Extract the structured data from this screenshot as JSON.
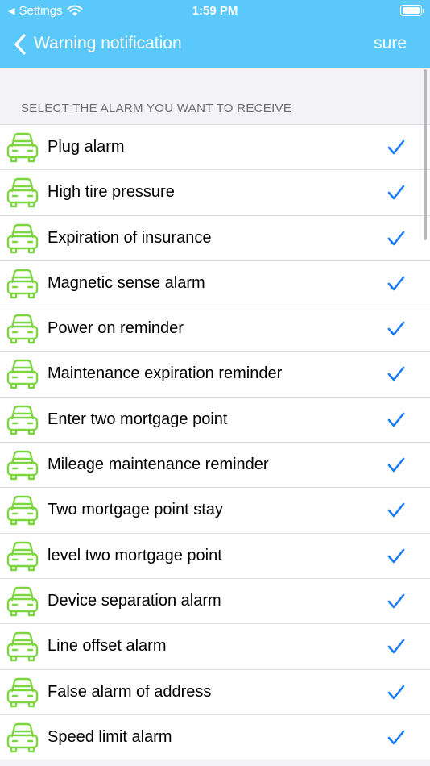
{
  "status_bar": {
    "back_app": "Settings",
    "time": "1:59 PM"
  },
  "nav": {
    "title": "Warning notification",
    "action": "sure"
  },
  "section": {
    "title": "SELECT THE ALARM YOU WANT TO RECEIVE"
  },
  "colors": {
    "header_bg": "#5ac8fa",
    "car_icon": "#7cd63d",
    "check": "#1a7cf5"
  },
  "alarms": [
    {
      "label": "Plug alarm",
      "checked": true
    },
    {
      "label": "High tire pressure",
      "checked": true
    },
    {
      "label": "Expiration of insurance",
      "checked": true
    },
    {
      "label": "Magnetic sense alarm",
      "checked": true
    },
    {
      "label": "Power on reminder",
      "checked": true
    },
    {
      "label": "Maintenance expiration reminder",
      "checked": true
    },
    {
      "label": "Enter two mortgage point",
      "checked": true
    },
    {
      "label": "Mileage maintenance reminder",
      "checked": true
    },
    {
      "label": "Two mortgage point stay",
      "checked": true
    },
    {
      "label": "level two mortgage point",
      "checked": true
    },
    {
      "label": "Device separation alarm",
      "checked": true
    },
    {
      "label": "Line offset alarm",
      "checked": true
    },
    {
      "label": "False alarm of address",
      "checked": true
    },
    {
      "label": "Speed limit alarm",
      "checked": true
    }
  ]
}
